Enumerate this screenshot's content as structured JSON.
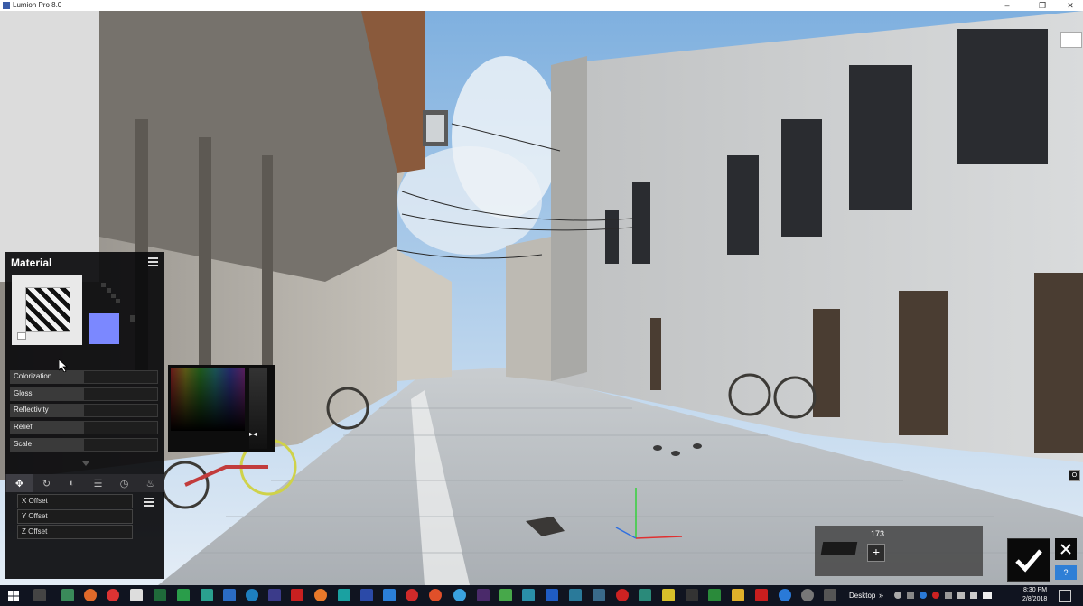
{
  "window": {
    "title": "Lumion Pro 8.0",
    "controls": {
      "minimize": "–",
      "maximize": "❐",
      "close": "✕"
    }
  },
  "material_panel": {
    "title": "Material",
    "swatch_color": "#7b88ff",
    "sliders": [
      {
        "label": "Colorization"
      },
      {
        "label": "Gloss"
      },
      {
        "label": "Reflectivity"
      },
      {
        "label": "Relief"
      },
      {
        "label": "Scale"
      }
    ],
    "tool_tabs": [
      "move-icon",
      "rotate-icon",
      "contrast-icon",
      "sliders-icon",
      "clock-icon",
      "fire-icon"
    ],
    "offsets": [
      {
        "label": "X Offset"
      },
      {
        "label": "Y Offset"
      },
      {
        "label": "Z Offset"
      }
    ]
  },
  "object_panel": {
    "count": "173",
    "add_label": "+"
  },
  "buttons": {
    "confirm": "✔",
    "move": "✥",
    "help": "?",
    "o_label": "O"
  },
  "taskbar": {
    "desktop_label": "Desktop",
    "time": "8:30 PM",
    "date": "2/8/2018"
  },
  "colors": {
    "accent_blue": "#2f7fd6",
    "panel_bg": "#0a0a0c",
    "sky": "#bcd6ee"
  }
}
